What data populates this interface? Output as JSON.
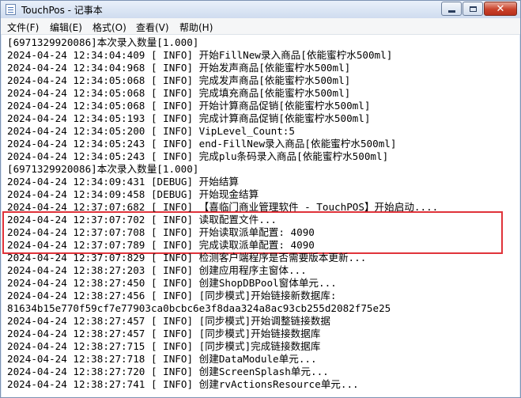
{
  "window": {
    "title": "TouchPos - 记事本",
    "icon": "notepad-icon",
    "buttons": {
      "minimize": "minimize-icon",
      "maximize": "maximize-icon",
      "close_glyph": "✕"
    }
  },
  "menu": [
    {
      "id": "file",
      "label": "文件(F)"
    },
    {
      "id": "edit",
      "label": "编辑(E)"
    },
    {
      "id": "format",
      "label": "格式(O)"
    },
    {
      "id": "view",
      "label": "查看(V)"
    },
    {
      "id": "help",
      "label": "帮助(H)"
    }
  ],
  "highlight": {
    "color": "#e0333a",
    "first_line": 11,
    "last_line": 13
  },
  "lines": [
    "[6971329920086]本次录入数量[1.000]",
    "2024-04-24 12:34:04:409 [ INFO] 开始FillNew录入商品[依能蜜柠水500ml]",
    "2024-04-24 12:34:04:968 [ INFO] 开始发声商品[依能蜜柠水500ml]",
    "2024-04-24 12:34:05:068 [ INFO] 完成发声商品[依能蜜柠水500ml]",
    "2024-04-24 12:34:05:068 [ INFO] 完成填充商品[依能蜜柠水500ml]",
    "2024-04-24 12:34:05:068 [ INFO] 开始计算商品促销[依能蜜柠水500ml]",
    "2024-04-24 12:34:05:193 [ INFO] 完成计算商品促销[依能蜜柠水500ml]",
    "2024-04-24 12:34:05:200 [ INFO] VipLevel_Count:5",
    "2024-04-24 12:34:05:243 [ INFO] end-FillNew录入商品[依能蜜柠水500ml]",
    "2024-04-24 12:34:05:243 [ INFO] 完成plu条码录入商品[依能蜜柠水500ml]",
    "[6971329920086]本次录入数量[1.000]",
    "2024-04-24 12:34:09:431 [DEBUG] 开始结算",
    "2024-04-24 12:34:09:458 [DEBUG] 开始现金结算",
    "2024-04-24 12:37:07:682 [ INFO] 【喜临门商业管理软件 - TouchPOS】开始启动....",
    "2024-04-24 12:37:07:702 [ INFO] 读取配置文件...",
    "2024-04-24 12:37:07:708 [ INFO] 开始读取派单配置: 4090",
    "2024-04-24 12:37:07:789 [ INFO] 完成读取派单配置: 4090",
    "2024-04-24 12:37:07:829 [ INFO] 检测客户端程序是否需要版本更新...",
    "2024-04-24 12:38:27:203 [ INFO] 创建应用程序主窗体...",
    "2024-04-24 12:38:27:450 [ INFO] 创建ShopDBPool窗体单元...",
    "2024-04-24 12:38:27:456 [ INFO] [同步模式]开始链接新数据库:",
    "81634b15e770f59cf7e77903ca0bcbc6e3f8daa324a8ac93cb255d2082f75e25",
    "2024-04-24 12:38:27:457 [ INFO] [同步模式]开始调整链接数据",
    "2024-04-24 12:38:27:457 [ INFO] [同步模式]开始链接数据库",
    "2024-04-24 12:38:27:715 [ INFO] [同步模式]完成链接数据库",
    "2024-04-24 12:38:27:718 [ INFO] 创建DataModule单元...",
    "2024-04-24 12:38:27:720 [ INFO] 创建ScreenSplash单元...",
    "2024-04-24 12:38:27:741 [ INFO] 创建rvActionsResource单元..."
  ]
}
